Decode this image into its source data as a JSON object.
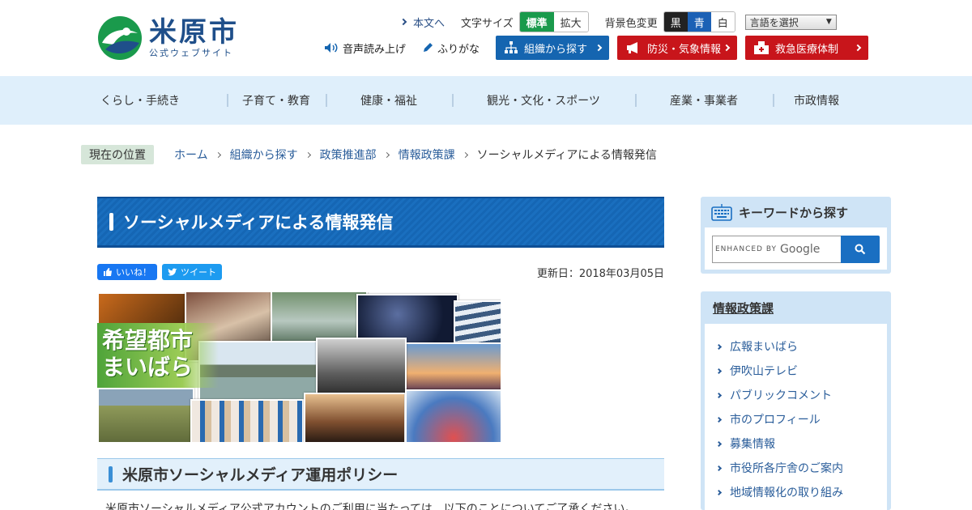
{
  "header": {
    "logo_name": "米原市",
    "logo_sub": "公式ウェブサイト",
    "skip_link": "本文へ",
    "font_size_label": "文字サイズ",
    "font_standard": "標準",
    "font_large": "拡大",
    "bg_color_label": "背景色変更",
    "bg_black": "黒",
    "bg_blue": "青",
    "bg_white": "白",
    "language_select": "言語を選択",
    "read_aloud": "音声読み上げ",
    "furigana": "ふりがな",
    "org_search": "組織から探す",
    "disaster_info": "防災・気象情報",
    "emergency_medical": "救急医療体制"
  },
  "nav": {
    "items": [
      {
        "label": "くらし・手続き"
      },
      {
        "label": "子育て・教育"
      },
      {
        "label": "健康・福祉"
      },
      {
        "label": "観光・文化・スポーツ"
      },
      {
        "label": "産業・事業者"
      },
      {
        "label": "市政情報"
      }
    ]
  },
  "breadcrumb": {
    "label": "現在の位置",
    "items": [
      "ホーム",
      "組織から探す",
      "政策推進部",
      "情報政策課"
    ],
    "current": "ソーシャルメディアによる情報発信"
  },
  "main": {
    "title": "ソーシャルメディアによる情報発信",
    "like_label": "いいね！",
    "tweet_label": "ツイート",
    "updated": "更新日：2018年03月05日",
    "banner_text_line1": "希望都市",
    "banner_text_line2": "まいばら",
    "section_title": "米原市ソーシャルメディア運用ポリシー",
    "body_text": "米原市ソーシャルメディア公式アカウントのご利用に当たっては、以下のことについてご了承ください。"
  },
  "sidebar": {
    "keyword_title": "キーワードから探す",
    "search_enhanced": "ENHANCED BY",
    "search_google": "Google",
    "dept_title": "情報政策課",
    "links": [
      "広報まいばら",
      "伊吹山テレビ",
      "パブリックコメント",
      "市のプロフィール",
      "募集情報",
      "市役所各庁舎のご案内",
      "地域情報化の取り組み"
    ]
  },
  "colors": {
    "brand_blue": "#1566b4",
    "accent_green": "#1a9a4c",
    "alert_red": "#c8151b",
    "nav_bg": "#dfeffb"
  }
}
